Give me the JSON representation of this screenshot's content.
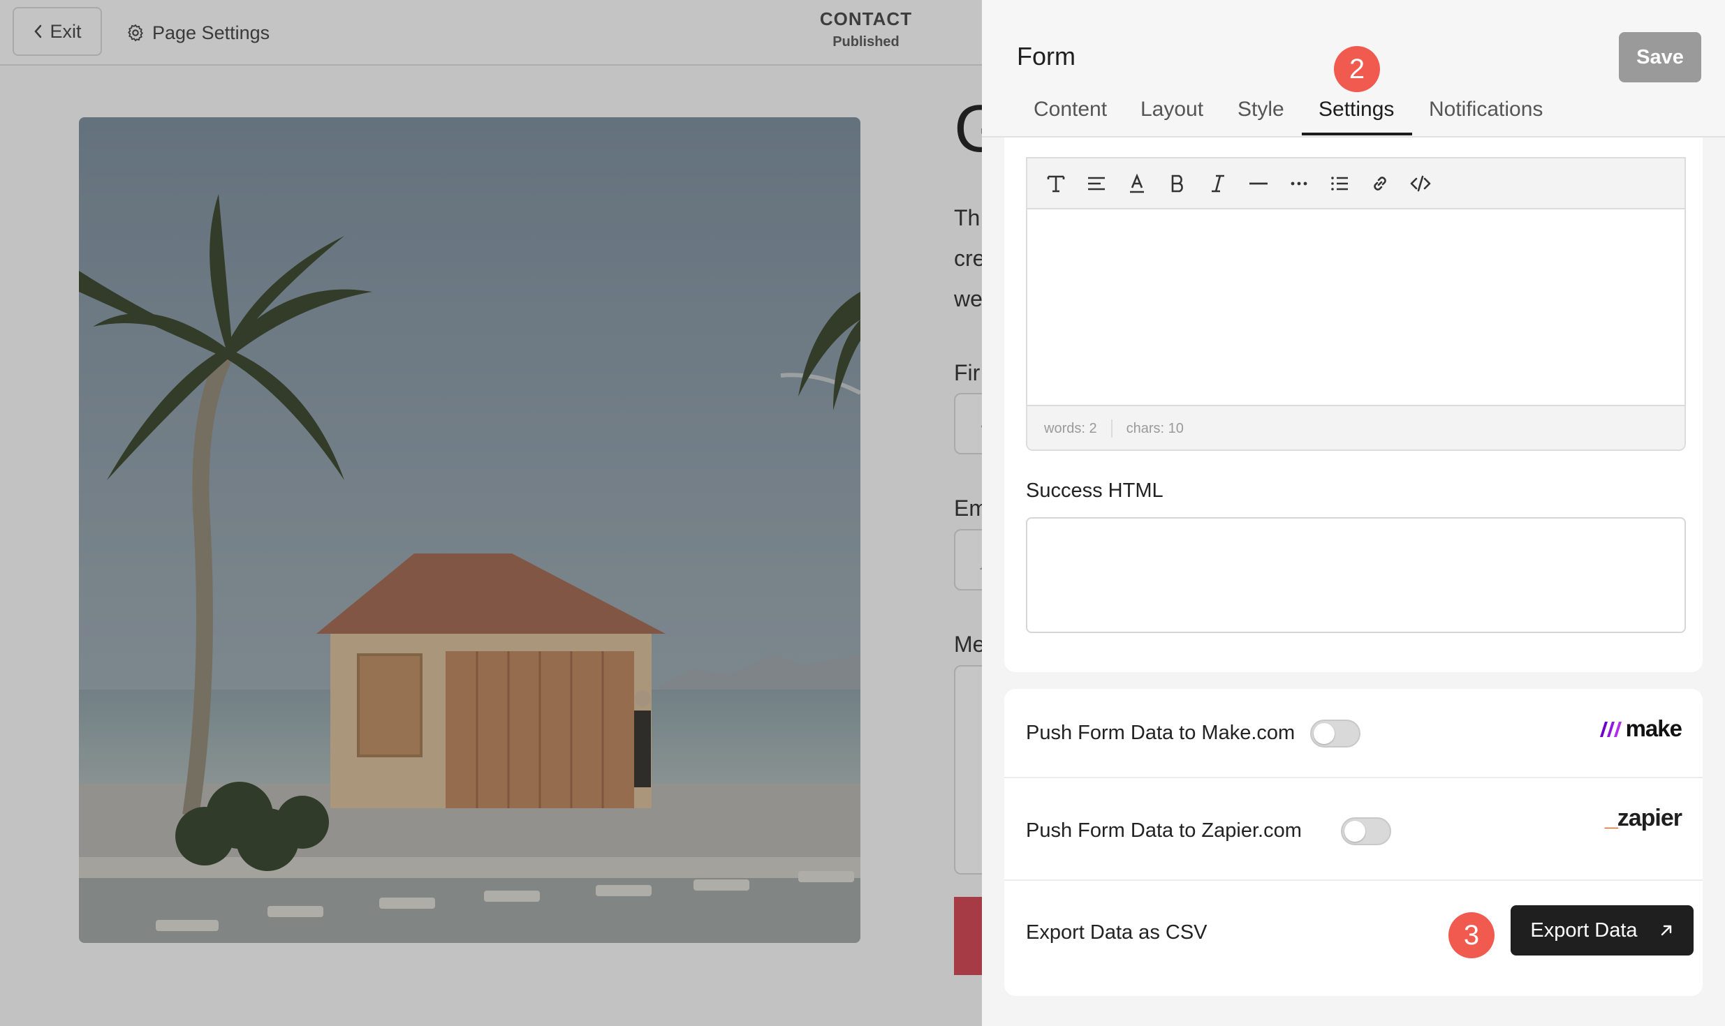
{
  "topbar": {
    "exit_label": "Exit",
    "page_settings_label": "Page Settings",
    "page_name": "CONTACT",
    "page_status": "Published"
  },
  "page_behind": {
    "fragments": [
      "G",
      "Th",
      "cre",
      "we",
      "Fir",
      "Em",
      "Me"
    ],
    "input_fragments": [
      "J",
      "j"
    ]
  },
  "panel": {
    "title": "Form",
    "save_label": "Save",
    "tabs": [
      {
        "label": "Content"
      },
      {
        "label": "Layout"
      },
      {
        "label": "Style"
      },
      {
        "label": "Settings",
        "active": true
      },
      {
        "label": "Notifications"
      }
    ],
    "step_markers": [
      "2",
      "3"
    ]
  },
  "editor": {
    "toolbar_icons": [
      "text-style-icon",
      "align-icon",
      "text-color-icon",
      "bold-icon",
      "italic-icon",
      "horizontal-rule-icon",
      "more-icon",
      "list-icon",
      "link-icon",
      "code-icon"
    ],
    "words_label": "words: 2",
    "chars_label": "chars: 10"
  },
  "success_html": {
    "label": "Success HTML",
    "value": ""
  },
  "integrations": {
    "make_label": "Push Form Data to Make.com",
    "make_enabled": false,
    "make_logo_text": "make",
    "zapier_label": "Push Form Data to Zapier.com",
    "zapier_enabled": false,
    "zapier_logo_text": "zapier",
    "export_label": "Export Data as CSV",
    "export_button": "Export Data"
  },
  "colors": {
    "accent_step": "#f05a4f",
    "save_disabled": "#9a9a9a",
    "export_button": "#1f1f1f",
    "zapier_orange": "#ff4f00",
    "make_gradient": [
      "#6d00cc",
      "#b02de9"
    ]
  }
}
